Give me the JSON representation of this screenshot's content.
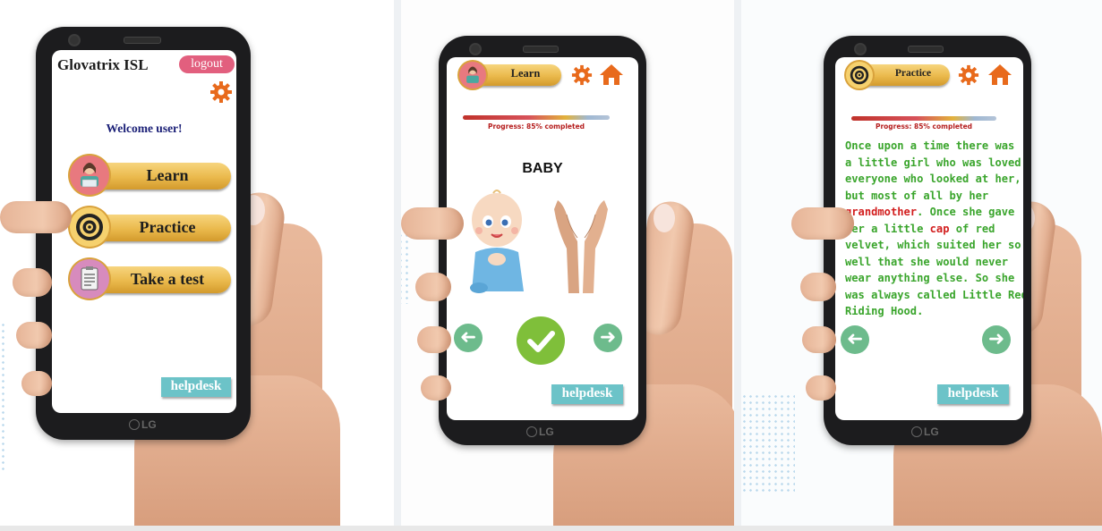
{
  "colors": {
    "gold": "#eab94c",
    "logout_pink": "#e25f7e",
    "helpdesk_teal": "#6cc3c8",
    "gear_orange": "#e86a1c",
    "arrow_green": "#6dbb8c",
    "check_green": "#7fbf3a",
    "story_green": "#3aa52c",
    "story_red": "#d21e1e",
    "title_navy": "#1b2077"
  },
  "brand": {
    "lg": "LG"
  },
  "screen_home": {
    "app_title": "Glovatrix ISL",
    "logout_label": "logout",
    "welcome": "Welcome user!",
    "menu": [
      {
        "label": "Learn",
        "icon": "teacher-icon"
      },
      {
        "label": "Practice",
        "icon": "target-icon"
      },
      {
        "label": "Take a test",
        "icon": "clipboard-icon"
      }
    ],
    "helpdesk_label": "helpdesk"
  },
  "screen_learn": {
    "header_label": "Learn",
    "progress": 0.85,
    "progress_text": "Progress: 85% completed",
    "word": "BABY",
    "helpdesk_label": "helpdesk"
  },
  "screen_practice": {
    "header_label": "Practice",
    "progress": 0.85,
    "progress_text": "Progress: 85% completed",
    "story_lines": [
      "Once upon a time there was",
      "a little girl who was loved by",
      "everyone who looked at her,",
      "but most of all by her",
      "grandmother. Once she gave",
      "her a little cap of red",
      "velvet, which suited her so",
      "well that she would never",
      "wear anything else. So she",
      "was always called Little Red",
      "Riding Hood."
    ],
    "highlighted_words": [
      "grandmother",
      "cap"
    ],
    "helpdesk_label": "helpdesk"
  }
}
